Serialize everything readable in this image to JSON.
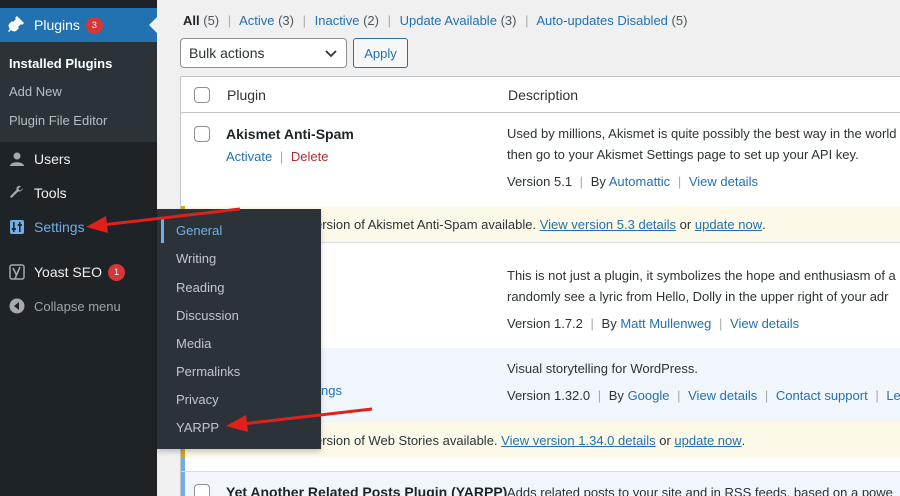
{
  "sidebar": {
    "plugins": {
      "label": "Plugins",
      "badge": "3"
    },
    "submenu": [
      {
        "label": "Installed Plugins",
        "current": true
      },
      {
        "label": "Add New"
      },
      {
        "label": "Plugin File Editor"
      }
    ],
    "users": "Users",
    "tools": "Tools",
    "settings": "Settings",
    "yoast": {
      "label": "Yoast SEO",
      "badge": "1"
    },
    "collapse": "Collapse menu"
  },
  "flyout": {
    "items": [
      "General",
      "Writing",
      "Reading",
      "Discussion",
      "Media",
      "Permalinks",
      "Privacy",
      "YARPP"
    ],
    "current": "General"
  },
  "filters": {
    "all": {
      "label": "All",
      "count": "(5)"
    },
    "active": {
      "label": "Active",
      "count": "(3)"
    },
    "inactive": {
      "label": "Inactive",
      "count": "(2)"
    },
    "update": {
      "label": "Update Available",
      "count": "(3)"
    },
    "autoupdates": {
      "label": "Auto-updates Disabled",
      "count": "(5)"
    }
  },
  "bulk": {
    "selected": "Bulk actions",
    "apply": "Apply"
  },
  "table": {
    "col_plugin": "Plugin",
    "col_description": "Description"
  },
  "plugins": {
    "akismet": {
      "name": "Akismet Anti-Spam",
      "activate": "Activate",
      "delete": "Delete",
      "desc1": "Used by millions, Akismet is quite possibly the best way in the world",
      "desc2": "then go to your Akismet Settings page to set up your API key.",
      "version": "Version 5.1",
      "by": "By",
      "author": "Automattic",
      "details": "View details",
      "notice_text": "new version of Akismet Anti-Spam available.",
      "notice_link": "View version 5.3 details",
      "notice_or": "or",
      "notice_update": "update now",
      "notice_end": "."
    },
    "hello": {
      "desc1": "This is not just a plugin, it symbolizes the hope and enthusiasm of a",
      "desc2": "randomly see a lyric from Hello, Dolly in the upper right of your adr",
      "version": "Version 1.7.2",
      "by": "By",
      "author": "Matt Mullenweg",
      "details": "View details"
    },
    "webstories": {
      "action_partial": "ngs",
      "desc1": "Visual storytelling for WordPress.",
      "version": "Version 1.32.0",
      "by": "By",
      "author": "Google",
      "details": "View details",
      "support": "Contact support",
      "leave": "Leave re",
      "notice_text": "new version of Web Stories available.",
      "notice_link": "View version 1.34.0 details",
      "notice_or": "or",
      "notice_update": "update now",
      "notice_end": "."
    },
    "yarpp": {
      "name": "Yet Another Related Posts Plugin (YARPP)",
      "desc1": "Adds related posts to your site and in RSS feeds, based on a powe"
    }
  },
  "colors": {
    "sidebar": "#1d2327",
    "accent": "#2271b1",
    "highlight": "#72aee6",
    "badge": "#d63638",
    "arrow": "#e0201b"
  }
}
